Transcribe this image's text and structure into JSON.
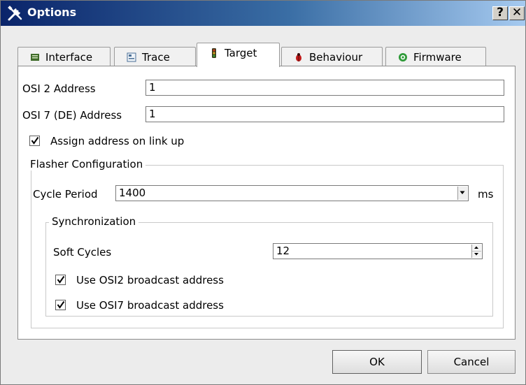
{
  "window": {
    "title": "Options",
    "help_label": "?",
    "close_label": "✕"
  },
  "tabs": [
    {
      "label": "Interface",
      "icon": "interface-icon"
    },
    {
      "label": "Trace",
      "icon": "trace-icon"
    },
    {
      "label": "Target",
      "icon": "traffic-light-icon",
      "active": true
    },
    {
      "label": "Behaviour",
      "icon": "ladybug-icon"
    },
    {
      "label": "Firmware",
      "icon": "gear-icon"
    }
  ],
  "target": {
    "osi2_label": "OSI 2 Address",
    "osi2_value": "1",
    "osi7_label": "OSI 7 (DE) Address",
    "osi7_value": "1",
    "assign_label": "Assign address on link up",
    "assign_checked": true,
    "flasher": {
      "title": "Flasher Configuration",
      "cycle_label": "Cycle Period",
      "cycle_value": "1400",
      "cycle_unit": "ms",
      "sync": {
        "title": "Synchronization",
        "soft_label": "Soft Cycles",
        "soft_value": "12",
        "osi2_broadcast_label": "Use OSI2 broadcast address",
        "osi2_broadcast_checked": true,
        "osi7_broadcast_label": "Use OSI7 broadcast address",
        "osi7_broadcast_checked": true
      }
    }
  },
  "buttons": {
    "ok": "OK",
    "cancel": "Cancel"
  },
  "colors": {
    "titlebar_start": "#0a246a",
    "titlebar_end": "#a6caf0",
    "window_bg": "#ececec"
  }
}
